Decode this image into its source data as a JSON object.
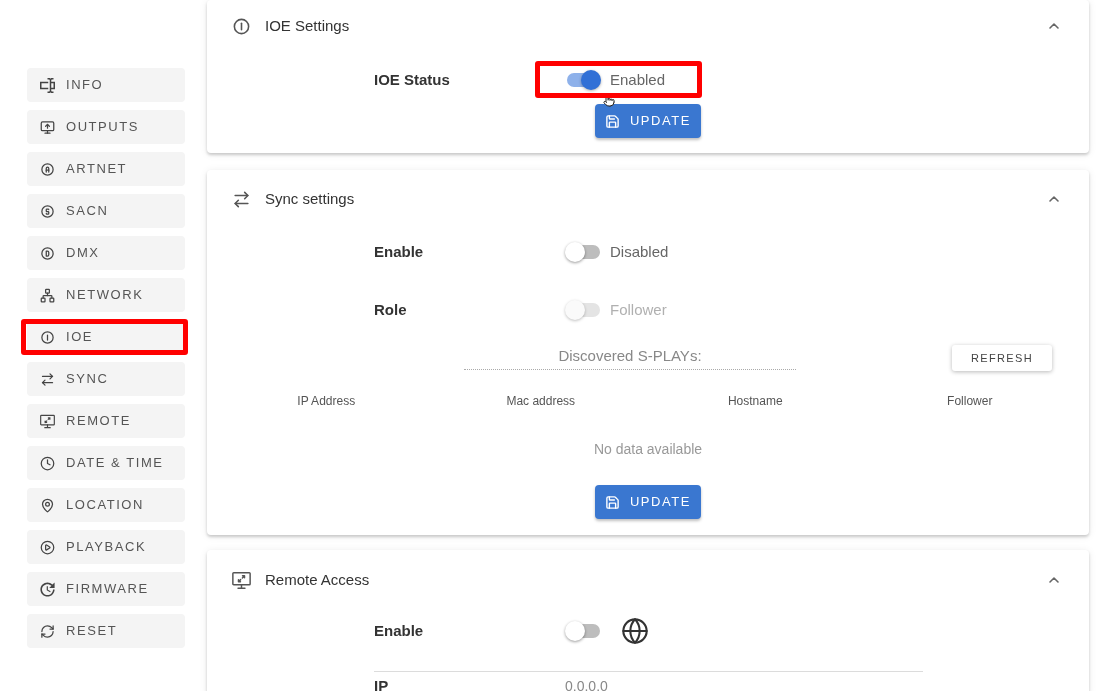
{
  "sidebar": {
    "items": [
      {
        "label": "INFO",
        "highlighted": false
      },
      {
        "label": "OUTPUTS",
        "highlighted": false
      },
      {
        "label": "ARTNET",
        "highlighted": false
      },
      {
        "label": "SACN",
        "highlighted": false
      },
      {
        "label": "DMX",
        "highlighted": false
      },
      {
        "label": "NETWORK",
        "highlighted": false
      },
      {
        "label": "IOE",
        "highlighted": true
      },
      {
        "label": "SYNC",
        "highlighted": false
      },
      {
        "label": "REMOTE",
        "highlighted": false
      },
      {
        "label": "DATE & TIME",
        "highlighted": false
      },
      {
        "label": "LOCATION",
        "highlighted": false
      },
      {
        "label": "PLAYBACK",
        "highlighted": false
      },
      {
        "label": "FIRMWARE",
        "highlighted": false
      },
      {
        "label": "RESET",
        "highlighted": false
      }
    ]
  },
  "sections": [
    {
      "kind": "ioe",
      "title": "IOE Settings",
      "expanded": true,
      "fields": [
        {
          "kind": "toggle",
          "label": "IOE Status",
          "on": true,
          "disabled": false,
          "state_text": "Enabled",
          "highlighted": true,
          "hovered": true
        }
      ],
      "update_button": "UPDATE"
    },
    {
      "kind": "sync",
      "title": "Sync settings",
      "expanded": true,
      "fields": [
        {
          "kind": "toggle",
          "label": "Enable",
          "on": false,
          "disabled": false,
          "state_text": "Disabled",
          "highlighted": false,
          "hovered": false
        },
        {
          "kind": "toggle",
          "label": "Role",
          "on": false,
          "disabled": true,
          "state_text": "Follower",
          "highlighted": false,
          "hovered": false
        }
      ],
      "discovered": {
        "value": "Discovered S-PLAYs:",
        "refresh_button": "REFRESH",
        "columns": [
          "IP Address",
          "Mac address",
          "Hostname",
          "Follower"
        ],
        "empty_text": "No data available"
      },
      "update_button": "UPDATE"
    },
    {
      "kind": "remote",
      "title": "Remote Access",
      "expanded": true,
      "fields": [
        {
          "kind": "globe_toggle",
          "label": "Enable",
          "on": false,
          "disabled": false
        },
        {
          "kind": "value",
          "label": "IP",
          "value": "0.0.0.0"
        }
      ]
    }
  ]
}
